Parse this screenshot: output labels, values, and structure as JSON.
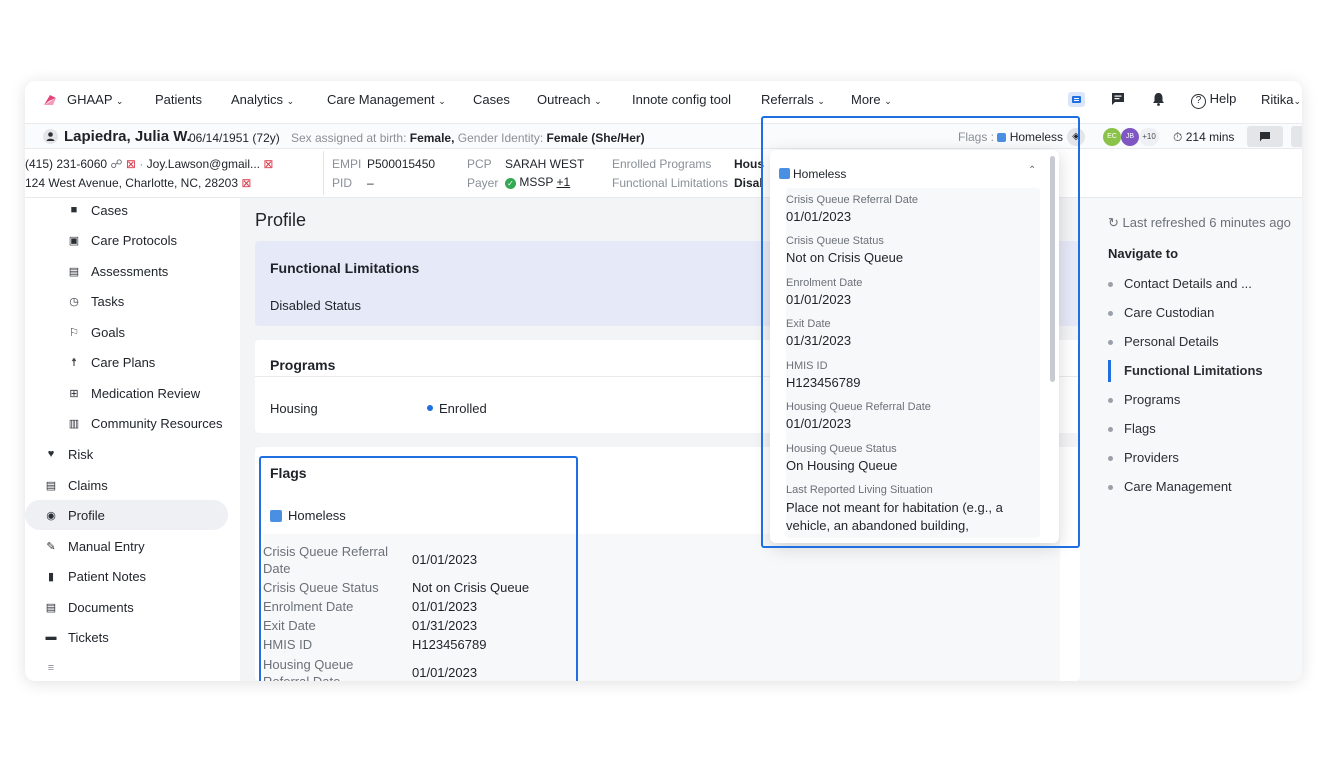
{
  "nav": {
    "org": "GHAAP",
    "items": [
      "Patients",
      "Analytics",
      "Care Management",
      "Cases",
      "Outreach",
      "Innote config tool",
      "Referrals",
      "More"
    ],
    "help": "Help",
    "user": "Ritika"
  },
  "patient": {
    "name": "Lapiedra, Julia W.",
    "dob": "06/14/1951 (72y)",
    "sex_label": "Sex assigned at birth:",
    "sex": "Female,",
    "gender_label": "Gender Identity:",
    "gender": "Female (She/Her)",
    "phone": "(415) 231-6060",
    "email": "Joy.Lawson@gmail...",
    "address": "124 West Avenue, Charlotte, NC, 28203",
    "empi_label": "EMPI",
    "empi": "P500015450",
    "pid_label": "PID",
    "pid": "–",
    "pcp_label": "PCP",
    "pcp": "SARAH WEST",
    "payer_label": "Payer",
    "payer": "MSSP",
    "payer_more": "+1",
    "programs_label": "Enrolled Programs",
    "programs_value": "Hous",
    "fl_label": "Functional Limitations",
    "fl_value": "Disal",
    "flags_label": "Flags :",
    "flags_value": "Homeless",
    "avatars": [
      "EC",
      "JB"
    ],
    "avatars_more": "+10",
    "timer": "214 mins"
  },
  "sidebar": {
    "sub_items": [
      "Cases",
      "Care Protocols",
      "Assessments",
      "Tasks",
      "Goals",
      "Care Plans",
      "Medication Review",
      "Community Resources"
    ],
    "items": [
      "Risk",
      "Claims",
      "Profile",
      "Manual Entry",
      "Patient Notes",
      "Documents",
      "Tickets"
    ]
  },
  "main": {
    "title": "Profile",
    "fl_title": "Functional Limitations",
    "fl_value": "Disabled Status",
    "programs_title": "Programs",
    "program_name": "Housing",
    "program_status": "Enrolled",
    "flags_title": "Flags",
    "flag_name": "Homeless",
    "flag_rows": [
      {
        "label": "Crisis Queue Referral Date",
        "value": "01/01/2023"
      },
      {
        "label": "Crisis Queue Status",
        "value": "Not on Crisis Queue"
      },
      {
        "label": "Enrolment Date",
        "value": "01/01/2023"
      },
      {
        "label": "Exit Date",
        "value": "01/31/2023"
      },
      {
        "label": "HMIS ID",
        "value": "H123456789"
      },
      {
        "label": "Housing Queue Referral Date",
        "value": "01/01/2023"
      }
    ]
  },
  "popover": {
    "title": "Homeless",
    "fields": [
      {
        "label": "Crisis Queue Referral Date",
        "value": "01/01/2023"
      },
      {
        "label": "Crisis Queue Status",
        "value": "Not on Crisis Queue"
      },
      {
        "label": "Enrolment Date",
        "value": "01/01/2023"
      },
      {
        "label": "Exit Date",
        "value": "01/31/2023"
      },
      {
        "label": "HMIS ID",
        "value": "H123456789"
      },
      {
        "label": "Housing Queue Referral Date",
        "value": "01/01/2023"
      },
      {
        "label": "Housing Queue Status",
        "value": "On Housing Queue"
      },
      {
        "label": "Last Reported Living Situation",
        "value": "Place not meant for habitation (e.g., a vehicle, an abandoned building,"
      }
    ]
  },
  "right": {
    "refreshed": "Last refreshed 6 minutes ago",
    "navigate_title": "Navigate to",
    "links": [
      "Contact Details and ...",
      "Care Custodian",
      "Personal Details",
      "Functional Limitations",
      "Programs",
      "Flags",
      "Providers",
      "Care Management"
    ]
  },
  "colors": {
    "accent": "#1f6fe0",
    "flag_blue": "#4a90e2",
    "fl_card_bg": "#e6e9f7",
    "enrolled_dot": "#1f6fe0"
  }
}
